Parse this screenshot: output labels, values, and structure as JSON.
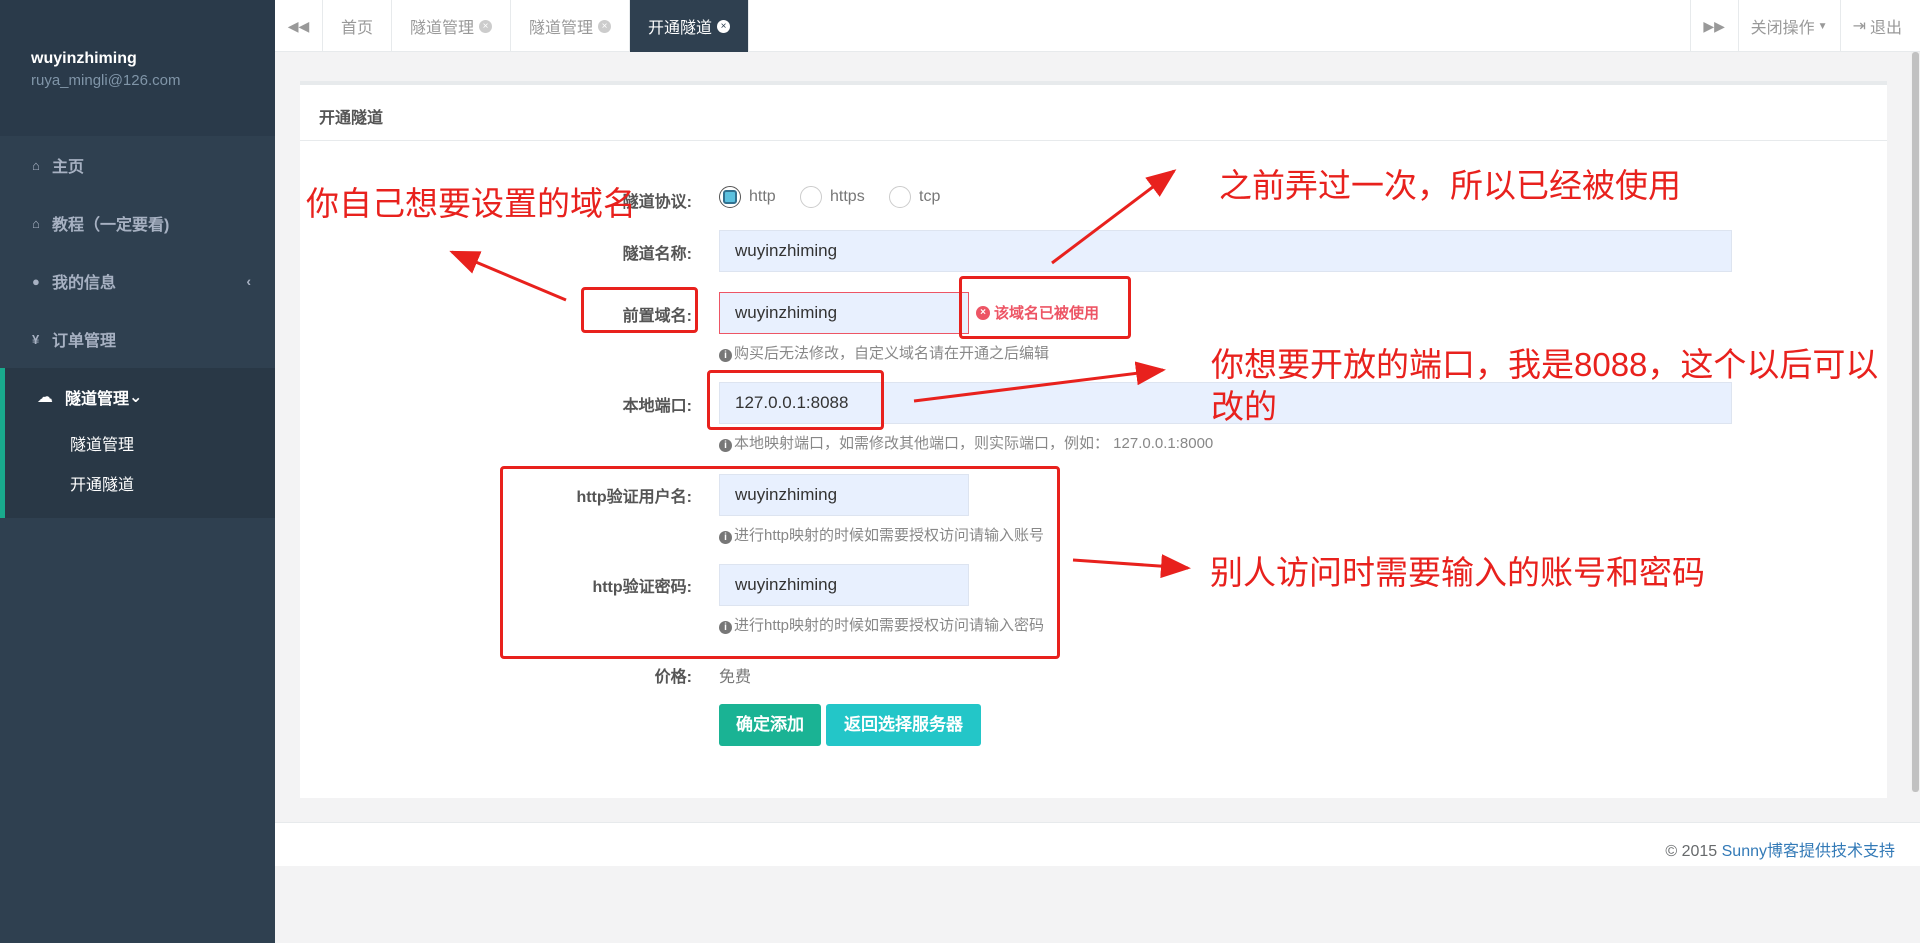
{
  "sidebar": {
    "username": "wuyinzhiming",
    "email": "ruya_mingli@126.com",
    "items": [
      {
        "label": "主页"
      },
      {
        "label": "教程（一定要看)"
      },
      {
        "label": "我的信息"
      },
      {
        "label": "订单管理"
      },
      {
        "label": "隧道管理"
      }
    ],
    "subitems": [
      {
        "label": "隧道管理"
      },
      {
        "label": "开通隧道"
      }
    ]
  },
  "tabs": [
    {
      "label": "首页"
    },
    {
      "label": "隧道管理"
    },
    {
      "label": "隧道管理"
    },
    {
      "label": "开通隧道"
    }
  ],
  "topright": {
    "close_ops": "关闭操作",
    "logout": "退出"
  },
  "panel": {
    "title": "开通隧道",
    "protocol_label": "隧道协议:",
    "protocols": [
      "http",
      "https",
      "tcp"
    ],
    "name_label": "隧道名称:",
    "name_value": "wuyinzhiming",
    "domain_label": "前置域名:",
    "domain_value": "wuyinzhiming",
    "domain_error": "该域名已被使用",
    "domain_help": "购买后无法修改，自定义域名请在开通之后编辑",
    "port_label": "本地端口:",
    "port_value": "127.0.0.1:8088",
    "port_help": "本地映射端口，如需修改其他端口，则实际端口，例如： 127.0.0.1:8000",
    "user_label": "http验证用户名:",
    "user_value": "wuyinzhiming",
    "user_help": "进行http映射的时候如需要授权访问请输入账号",
    "pass_label": "http验证密码:",
    "pass_value": "wuyinzhiming",
    "pass_help": "进行http映射的时候如需要授权访问请输入密码",
    "price_label": "价格:",
    "price_value": "免费",
    "confirm_btn": "确定添加",
    "back_btn": "返回选择服务器"
  },
  "annotations": {
    "domain_note": "你自己想要设置的域名",
    "used_note": "之前弄过一次，所以已经被使用",
    "port_note_1": "你想要开放的端口，我是8088，这个以后可以",
    "port_note_2": "改的",
    "auth_note": "别人访问时需要输入的账号和密码"
  },
  "footer": {
    "copyright": "© 2015 ",
    "link": "Sunny博客提供技术支持"
  },
  "colors": {
    "sidebar": "#2f4050",
    "accent": "#19aa8d",
    "annotation": "#e8211d",
    "button_primary": "#1ab394",
    "button_info": "#23c6c8"
  }
}
